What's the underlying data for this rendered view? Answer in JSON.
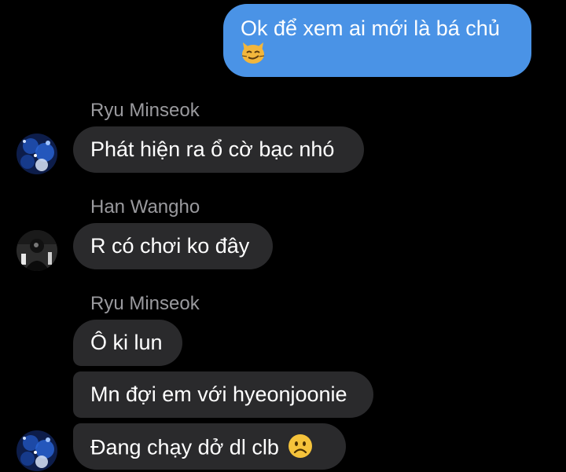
{
  "messages": [
    {
      "direction": "outgoing",
      "text": "Ok để xem ai mới là bá chủ",
      "emoji": "smirking-cat"
    },
    {
      "direction": "incoming",
      "sender": "Ryu Minseok",
      "text": "Phát hiện ra ổ cờ bạc nhó"
    },
    {
      "direction": "incoming",
      "sender": "Han Wangho",
      "text": "R có chơi ko đây"
    },
    {
      "direction": "incoming",
      "sender": "Ryu Minseok",
      "text": "Ô ki lun"
    },
    {
      "direction": "incoming",
      "text": "Mn đợi em với hyeonjoonie"
    },
    {
      "direction": "incoming",
      "text": "Đang chạy dở dl clb",
      "emoji": "frowning-face"
    }
  ],
  "colors": {
    "background": "#000000",
    "outgoing_bubble": "#4a93e6",
    "incoming_bubble": "#2a2a2c",
    "sender_name": "#9a9a9e"
  }
}
